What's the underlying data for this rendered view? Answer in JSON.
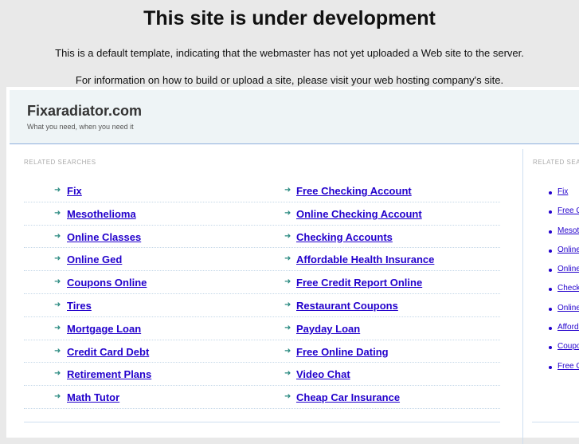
{
  "title": "This site is under development",
  "line1": "This is a default template, indicating that the webmaster has not yet uploaded a Web site to the server.",
  "line2": "For information on how to build or upload a site, please visit your web hosting company's site.",
  "site": {
    "name": "Fixaradiator.com",
    "tagline": "What you need, when you need it"
  },
  "related_label": "RELATED SEARCHES",
  "left": [
    "Fix",
    "Mesothelioma",
    "Online Classes",
    "Online Ged",
    "Coupons Online",
    "Tires",
    "Mortgage Loan",
    "Credit Card Debt",
    "Retirement Plans",
    "Math Tutor"
  ],
  "right": [
    "Free Checking Account",
    "Online Checking Account",
    "Checking Accounts",
    "Affordable Health Insurance",
    "Free Credit Report Online",
    "Restaurant Coupons",
    "Payday Loan",
    "Free Online Dating",
    "Video Chat",
    "Cheap Car Insurance"
  ],
  "side_label": "RELATED SEARCHES",
  "side": [
    "Fix",
    "Free Checking Account",
    "Mesothelioma",
    "Online Classes",
    "Online Checking Account",
    "Checking Accounts",
    "Online Ged",
    "Affordable Health Insurance",
    "Coupons Online",
    "Free Credit Report Online"
  ]
}
